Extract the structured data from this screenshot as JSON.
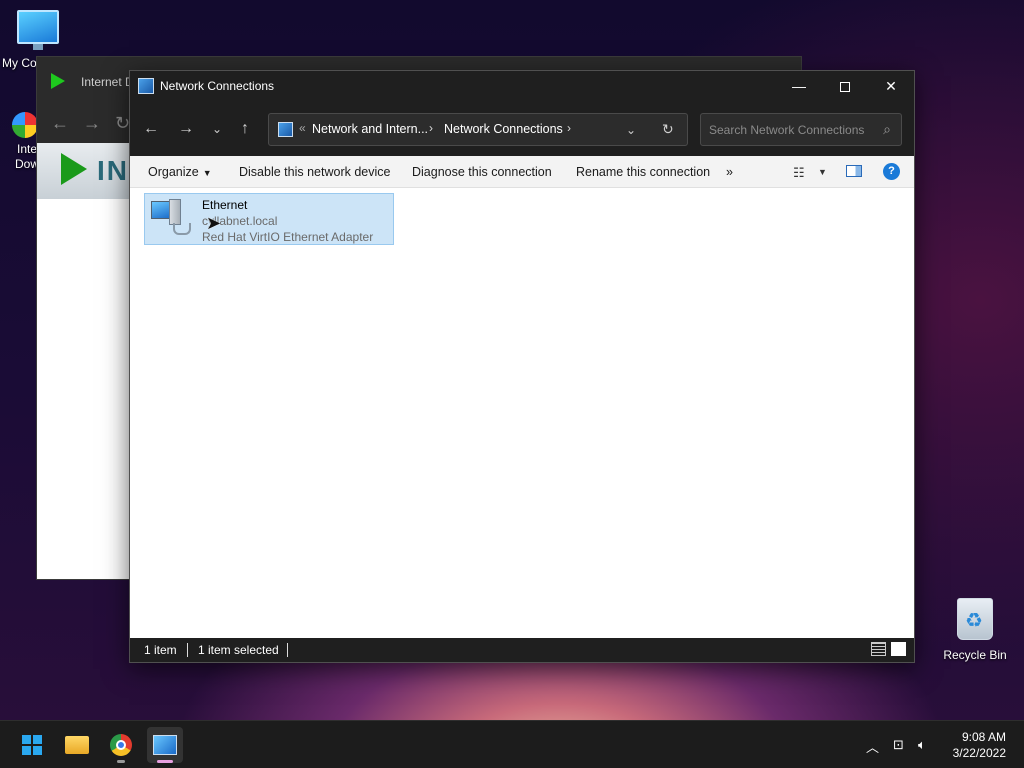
{
  "desktop": {
    "icons": [
      {
        "label": "My Co",
        "icon": "computer-icon"
      },
      {
        "label": "Inte Dow",
        "icon": "internet-download-manager-icon"
      },
      {
        "label": "Recycle Bin",
        "icon": "recycle-bin-icon"
      }
    ]
  },
  "background_window": {
    "title": "Internet D",
    "banner_text": "INT"
  },
  "window": {
    "title": "Network Connections",
    "controls": {
      "minimize": "—",
      "maximize": "",
      "close": "✕"
    }
  },
  "address": {
    "overflow": "«",
    "crumbs": [
      "Network and Intern...",
      "Network Connections"
    ],
    "separator": "›",
    "search_placeholder": "Search Network Connections"
  },
  "commands": {
    "organize": "Organize",
    "disable": "Disable this network device",
    "diagnose": "Diagnose this connection",
    "rename": "Rename this connection",
    "more": "»",
    "help": "?"
  },
  "items": [
    {
      "name": "Ethernet",
      "domain": "cyllabnet.local",
      "adapter": "Red Hat VirtIO Ethernet Adapter",
      "selected": true
    }
  ],
  "status": {
    "count": "1 item",
    "selected": "1 item selected"
  },
  "taskbar": {
    "apps": [
      "start",
      "file-explorer",
      "chrome",
      "network-connections"
    ],
    "time": "9:08 AM",
    "date": "3/22/2022"
  },
  "colors": {
    "selection_bg": "#cce4f7",
    "selection_border": "#99c9ef",
    "dark_chrome": "#1f1f1f",
    "accent": "#1a7ad8"
  }
}
